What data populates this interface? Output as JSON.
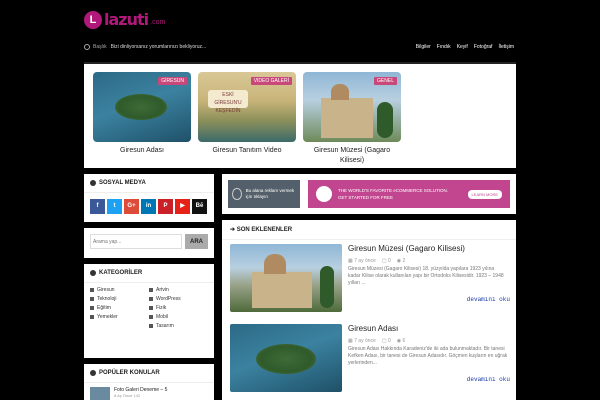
{
  "header": {
    "logo_text": "lazuti",
    "logo_sub": ".com",
    "ticker_label": "Başlık",
    "ticker_text": "Bizi dinliyorsanız yorumlarınızı bekliyoruz...",
    "nav": [
      "Bilgiler",
      "Fındık",
      "Keyif",
      "Fotoğraf",
      "İletişim"
    ]
  },
  "featured": [
    {
      "badge": "GİRESUN",
      "title": "Giresun Adası"
    },
    {
      "badge": "VIDEO GALERİ",
      "title": "Giresun Tanıtım Video"
    },
    {
      "badge": "GENEL",
      "title": "Giresun Müzesi (Gagaro Kilisesi)"
    }
  ],
  "social": {
    "title": "SOSYAL MEDYA",
    "icons": [
      {
        "label": "f",
        "color": "#3b5998",
        "name": "facebook-icon"
      },
      {
        "label": "t",
        "color": "#1da1f2",
        "name": "twitter-icon"
      },
      {
        "label": "G+",
        "color": "#dd4b39",
        "name": "googleplus-icon"
      },
      {
        "label": "in",
        "color": "#0077b5",
        "name": "linkedin-icon"
      },
      {
        "label": "P",
        "color": "#cb2027",
        "name": "pinterest-icon"
      },
      {
        "label": "▶",
        "color": "#e62117",
        "name": "youtube-icon"
      },
      {
        "label": "Bē",
        "color": "#111111",
        "name": "behance-icon"
      }
    ]
  },
  "search": {
    "placeholder": "Arama yap...",
    "button": "ARA"
  },
  "categories": {
    "title": "KATEGORİLER",
    "items": [
      "Giresun",
      "Artvin",
      "Teknoloji",
      "WordPress",
      "Eğitim",
      "Fizik",
      "Yemekler",
      "Mobil",
      "",
      "Tasarım"
    ]
  },
  "popular": {
    "title": "POPÜLER KONULAR",
    "items": [
      {
        "title": "Foto Galeri Deneme – 5",
        "meta": "8 Ay Önce   142"
      }
    ]
  },
  "ads": {
    "ad1": "Bu alana reklam vermek için tıklayın",
    "ad2_line1": "THE WORLD'S FAVORITE eCOMMERCE SOLUTION.",
    "ad2_line2": "GET STARTED FOR FREE",
    "ad2_button": "LEARN MORE"
  },
  "recent": {
    "title": "SON EKLENENLER",
    "posts": [
      {
        "title": "Giresun Müzesi (Gagaro Kilisesi)",
        "date": "7 ay önce",
        "comments": "0",
        "views": "2",
        "excerpt": "Giresun Müzesi (Gagaro Kilisesi) 18. yüzyılda yapılara 1923 yılına kadar Kilise olarak kullanılan yapı bir Ortodoks Kilisesidir. 1923 – 1948 yılları ...",
        "more": "devamını oku"
      },
      {
        "title": "Giresun Adası",
        "date": "7 ay önce",
        "comments": "0",
        "views": "6",
        "excerpt": "Giresun Adası Hakkında Karadeniz'de iki ada bulunmaktadır. Bir tanesi Kefken Adası, bir tanesi de Giresun Adasıdır. Göçmen kuşların en uğrak yerlerinden...",
        "more": "devamını oku"
      }
    ]
  }
}
